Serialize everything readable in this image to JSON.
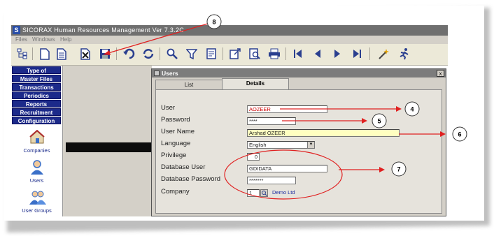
{
  "app": {
    "title": "SICORAX Human Resources Management Ver 7.3.2C",
    "icon_letter": "S"
  },
  "menu": [
    "Files",
    "Windows",
    "Help"
  ],
  "toolbar_icons": [
    "tree-icon",
    "new-document-icon",
    "open-document-icon",
    "delete-icon",
    "save-icon",
    "undo-icon",
    "refresh-icon",
    "search-icon",
    "filter-icon",
    "sort-icon",
    "export-icon",
    "preview-icon",
    "print-icon",
    "first-record-icon",
    "previous-record-icon",
    "next-record-icon",
    "last-record-icon",
    "wizard-icon",
    "exit-icon"
  ],
  "sidebar": {
    "buttons": [
      "Type of",
      "Master Files",
      "Transactions",
      "Periodics",
      "Reports",
      "Recruitment",
      "Configuration"
    ],
    "modules": [
      {
        "label": "Companies",
        "icon": "companies-icon"
      },
      {
        "label": "Users",
        "icon": "user-icon"
      },
      {
        "label": "User Groups",
        "icon": "user-groups-icon"
      }
    ]
  },
  "window": {
    "title": "Users",
    "close": "x",
    "tabs": [
      "List",
      "Details"
    ],
    "active_tab": "Details",
    "fields": [
      {
        "label": "User",
        "value": "AOZEER",
        "value_color": "#cc0000"
      },
      {
        "label": "Password",
        "value": "****"
      },
      {
        "label": "User Name",
        "value": "Arshad OZEER",
        "highlight": "#ffffc0"
      },
      {
        "label": "Language",
        "value": "English"
      },
      {
        "label": "Privilege",
        "value": "0"
      },
      {
        "label": "Database User",
        "value": "GDIDATA"
      },
      {
        "label": "Database Password",
        "value": "*******"
      },
      {
        "label": "Company",
        "value": "1",
        "lookup_text": "Demo Ltd"
      }
    ]
  },
  "callouts": [
    "8",
    "4",
    "5",
    "6",
    "7"
  ],
  "colors": {
    "nav_button": "#1c2a8a",
    "callout_line": "#e02020",
    "titlebar": "#6f6f6f"
  }
}
